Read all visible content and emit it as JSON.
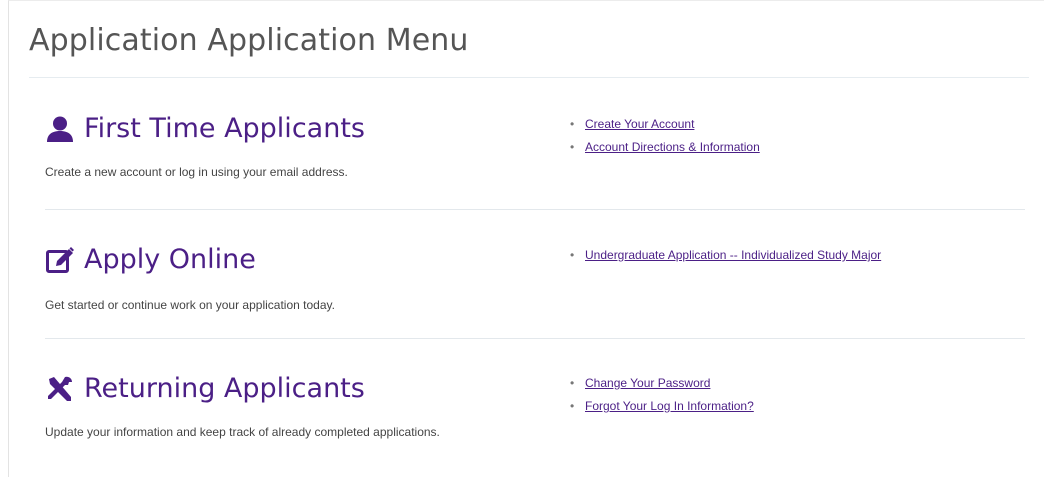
{
  "page": {
    "title": "Application Application Menu"
  },
  "theme": {
    "accent": "#4b1f86",
    "title_text": "#555555",
    "body_text": "#444444",
    "divider": "#e3e8ec"
  },
  "sections": [
    {
      "icon": "user-icon",
      "heading": "First Time Applicants",
      "description": "Create a new account or log in using your email address.",
      "links": [
        "Create Your Account",
        "Account Directions & Information"
      ]
    },
    {
      "icon": "edit-icon",
      "heading": "Apply Online",
      "description": "Get started or continue work on your application today.",
      "links": [
        "Undergraduate Application -- Individualized Study Major"
      ]
    },
    {
      "icon": "tools-icon",
      "heading": "Returning Applicants",
      "description": "Update your information and keep track of already completed applications.",
      "links": [
        "Change Your Password",
        "Forgot Your Log In Information?"
      ]
    }
  ]
}
